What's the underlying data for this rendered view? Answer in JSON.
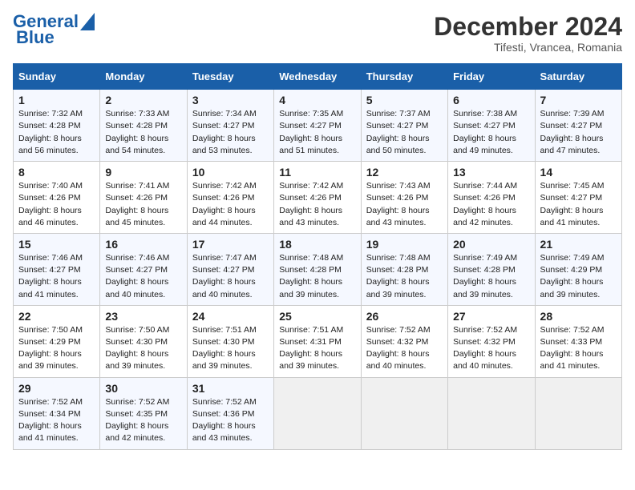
{
  "header": {
    "logo_line1": "General",
    "logo_line2": "Blue",
    "title": "December 2024",
    "subtitle": "Tifesti, Vrancea, Romania"
  },
  "columns": [
    "Sunday",
    "Monday",
    "Tuesday",
    "Wednesday",
    "Thursday",
    "Friday",
    "Saturday"
  ],
  "weeks": [
    [
      {
        "day": "1",
        "sunrise": "Sunrise: 7:32 AM",
        "sunset": "Sunset: 4:28 PM",
        "daylight": "Daylight: 8 hours and 56 minutes."
      },
      {
        "day": "2",
        "sunrise": "Sunrise: 7:33 AM",
        "sunset": "Sunset: 4:28 PM",
        "daylight": "Daylight: 8 hours and 54 minutes."
      },
      {
        "day": "3",
        "sunrise": "Sunrise: 7:34 AM",
        "sunset": "Sunset: 4:27 PM",
        "daylight": "Daylight: 8 hours and 53 minutes."
      },
      {
        "day": "4",
        "sunrise": "Sunrise: 7:35 AM",
        "sunset": "Sunset: 4:27 PM",
        "daylight": "Daylight: 8 hours and 51 minutes."
      },
      {
        "day": "5",
        "sunrise": "Sunrise: 7:37 AM",
        "sunset": "Sunset: 4:27 PM",
        "daylight": "Daylight: 8 hours and 50 minutes."
      },
      {
        "day": "6",
        "sunrise": "Sunrise: 7:38 AM",
        "sunset": "Sunset: 4:27 PM",
        "daylight": "Daylight: 8 hours and 49 minutes."
      },
      {
        "day": "7",
        "sunrise": "Sunrise: 7:39 AM",
        "sunset": "Sunset: 4:27 PM",
        "daylight": "Daylight: 8 hours and 47 minutes."
      }
    ],
    [
      {
        "day": "8",
        "sunrise": "Sunrise: 7:40 AM",
        "sunset": "Sunset: 4:26 PM",
        "daylight": "Daylight: 8 hours and 46 minutes."
      },
      {
        "day": "9",
        "sunrise": "Sunrise: 7:41 AM",
        "sunset": "Sunset: 4:26 PM",
        "daylight": "Daylight: 8 hours and 45 minutes."
      },
      {
        "day": "10",
        "sunrise": "Sunrise: 7:42 AM",
        "sunset": "Sunset: 4:26 PM",
        "daylight": "Daylight: 8 hours and 44 minutes."
      },
      {
        "day": "11",
        "sunrise": "Sunrise: 7:42 AM",
        "sunset": "Sunset: 4:26 PM",
        "daylight": "Daylight: 8 hours and 43 minutes."
      },
      {
        "day": "12",
        "sunrise": "Sunrise: 7:43 AM",
        "sunset": "Sunset: 4:26 PM",
        "daylight": "Daylight: 8 hours and 43 minutes."
      },
      {
        "day": "13",
        "sunrise": "Sunrise: 7:44 AM",
        "sunset": "Sunset: 4:26 PM",
        "daylight": "Daylight: 8 hours and 42 minutes."
      },
      {
        "day": "14",
        "sunrise": "Sunrise: 7:45 AM",
        "sunset": "Sunset: 4:27 PM",
        "daylight": "Daylight: 8 hours and 41 minutes."
      }
    ],
    [
      {
        "day": "15",
        "sunrise": "Sunrise: 7:46 AM",
        "sunset": "Sunset: 4:27 PM",
        "daylight": "Daylight: 8 hours and 41 minutes."
      },
      {
        "day": "16",
        "sunrise": "Sunrise: 7:46 AM",
        "sunset": "Sunset: 4:27 PM",
        "daylight": "Daylight: 8 hours and 40 minutes."
      },
      {
        "day": "17",
        "sunrise": "Sunrise: 7:47 AM",
        "sunset": "Sunset: 4:27 PM",
        "daylight": "Daylight: 8 hours and 40 minutes."
      },
      {
        "day": "18",
        "sunrise": "Sunrise: 7:48 AM",
        "sunset": "Sunset: 4:28 PM",
        "daylight": "Daylight: 8 hours and 39 minutes."
      },
      {
        "day": "19",
        "sunrise": "Sunrise: 7:48 AM",
        "sunset": "Sunset: 4:28 PM",
        "daylight": "Daylight: 8 hours and 39 minutes."
      },
      {
        "day": "20",
        "sunrise": "Sunrise: 7:49 AM",
        "sunset": "Sunset: 4:28 PM",
        "daylight": "Daylight: 8 hours and 39 minutes."
      },
      {
        "day": "21",
        "sunrise": "Sunrise: 7:49 AM",
        "sunset": "Sunset: 4:29 PM",
        "daylight": "Daylight: 8 hours and 39 minutes."
      }
    ],
    [
      {
        "day": "22",
        "sunrise": "Sunrise: 7:50 AM",
        "sunset": "Sunset: 4:29 PM",
        "daylight": "Daylight: 8 hours and 39 minutes."
      },
      {
        "day": "23",
        "sunrise": "Sunrise: 7:50 AM",
        "sunset": "Sunset: 4:30 PM",
        "daylight": "Daylight: 8 hours and 39 minutes."
      },
      {
        "day": "24",
        "sunrise": "Sunrise: 7:51 AM",
        "sunset": "Sunset: 4:30 PM",
        "daylight": "Daylight: 8 hours and 39 minutes."
      },
      {
        "day": "25",
        "sunrise": "Sunrise: 7:51 AM",
        "sunset": "Sunset: 4:31 PM",
        "daylight": "Daylight: 8 hours and 39 minutes."
      },
      {
        "day": "26",
        "sunrise": "Sunrise: 7:52 AM",
        "sunset": "Sunset: 4:32 PM",
        "daylight": "Daylight: 8 hours and 40 minutes."
      },
      {
        "day": "27",
        "sunrise": "Sunrise: 7:52 AM",
        "sunset": "Sunset: 4:32 PM",
        "daylight": "Daylight: 8 hours and 40 minutes."
      },
      {
        "day": "28",
        "sunrise": "Sunrise: 7:52 AM",
        "sunset": "Sunset: 4:33 PM",
        "daylight": "Daylight: 8 hours and 41 minutes."
      }
    ],
    [
      {
        "day": "29",
        "sunrise": "Sunrise: 7:52 AM",
        "sunset": "Sunset: 4:34 PM",
        "daylight": "Daylight: 8 hours and 41 minutes."
      },
      {
        "day": "30",
        "sunrise": "Sunrise: 7:52 AM",
        "sunset": "Sunset: 4:35 PM",
        "daylight": "Daylight: 8 hours and 42 minutes."
      },
      {
        "day": "31",
        "sunrise": "Sunrise: 7:52 AM",
        "sunset": "Sunset: 4:36 PM",
        "daylight": "Daylight: 8 hours and 43 minutes."
      },
      null,
      null,
      null,
      null
    ]
  ]
}
